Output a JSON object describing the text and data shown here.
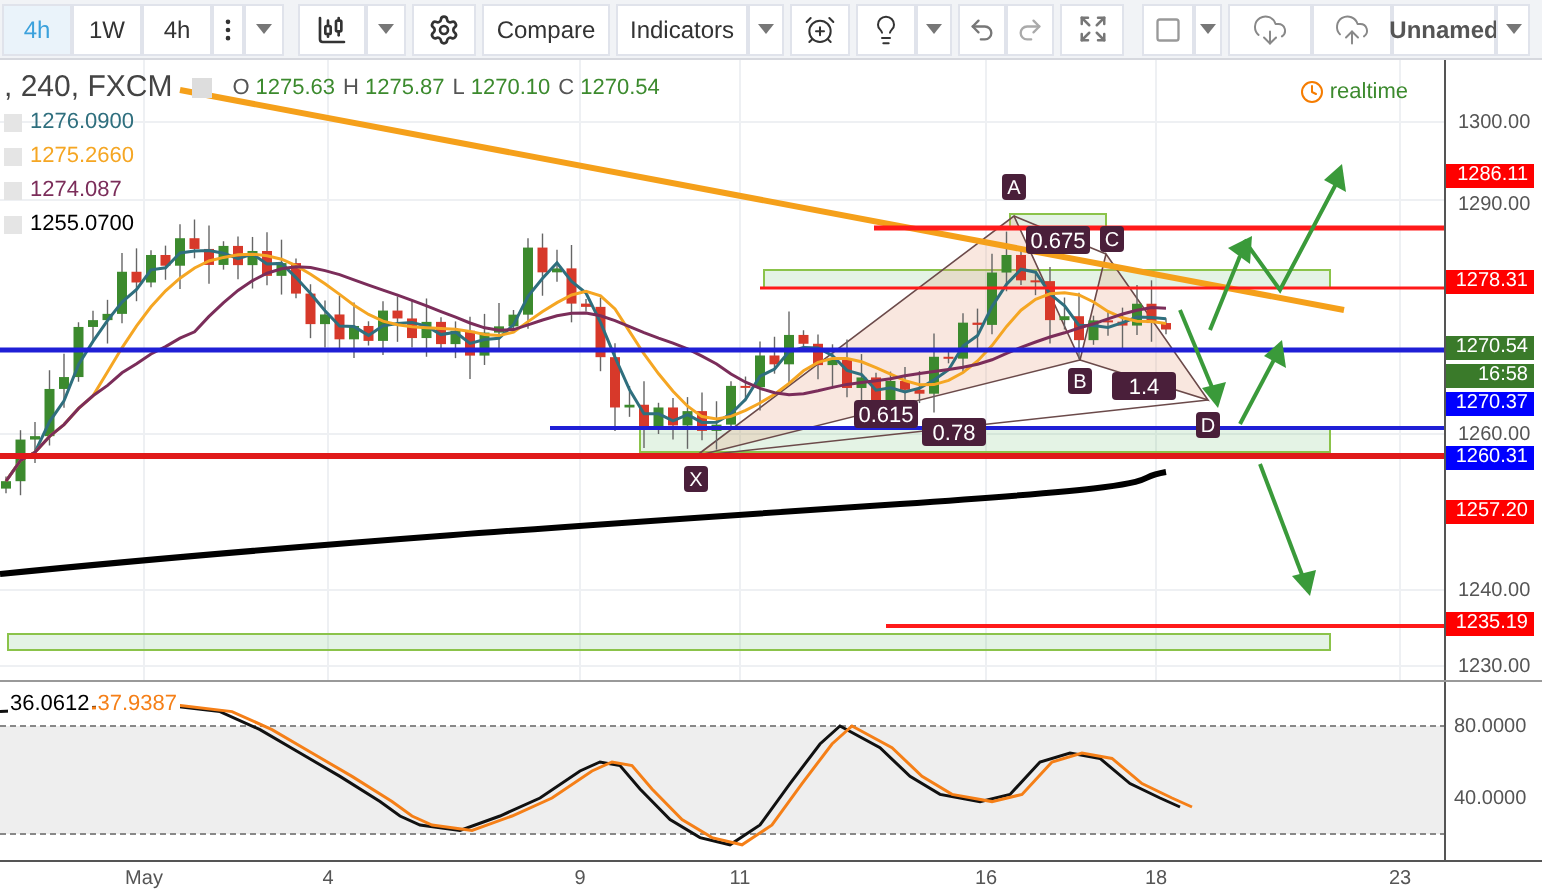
{
  "toolbar": {
    "interval_tabs": [
      {
        "label": "4h",
        "selected": true
      },
      {
        "label": "1W",
        "selected": false
      },
      {
        "label": "4h",
        "selected": false
      }
    ],
    "compare": "Compare",
    "indicators": "Indicators",
    "layout_name": "Unnamed"
  },
  "legend": {
    "symbol": ", 240, FXCM",
    "ohlc": [
      {
        "key": "O",
        "value": "1275.63"
      },
      {
        "key": "H",
        "value": "1275.87"
      },
      {
        "key": "L",
        "value": "1270.10"
      },
      {
        "key": "C",
        "value": "1270.54"
      }
    ],
    "indicators": [
      {
        "value": "1276.0900",
        "color": "#2f6f7e"
      },
      {
        "value": "1275.2660",
        "color": "#f5a623"
      },
      {
        "value": "1274.087",
        "color": "#7b2d5a"
      },
      {
        "value": "1255.0700",
        "color": "#000000"
      }
    ]
  },
  "realtime": "realtime",
  "pattern": {
    "points": [
      "X",
      "A",
      "B",
      "C",
      "D"
    ],
    "ratios": [
      "0.675",
      "0.615",
      "0.78",
      "1.4"
    ]
  },
  "price_axis": {
    "ticks": [
      "1300.00",
      "1290.00",
      "1260.00",
      "1240.00",
      "1230.00"
    ],
    "tags": [
      {
        "text": "1286.11",
        "color": "#ff0000"
      },
      {
        "text": "1278.31",
        "color": "#ff0000"
      },
      {
        "text": "1270.54",
        "color": "#3a7a2a"
      },
      {
        "text": "16:58",
        "color": "#3a7a2a"
      },
      {
        "text": "1270.37",
        "color": "#0000ff"
      },
      {
        "text": "1260.31",
        "color": "#0000ff"
      },
      {
        "text": "1257.20",
        "color": "#ff0000"
      },
      {
        "text": "1235.19",
        "color": "#ff0000"
      }
    ]
  },
  "oscillator": {
    "values": [
      {
        "text": "36.0612",
        "color": "#000000"
      },
      {
        "text": "37.9387",
        "color": "#f57f17"
      }
    ],
    "ticks": [
      "80.0000",
      "40.0000"
    ]
  },
  "time_axis": [
    "May",
    "4",
    "9",
    "11",
    "16",
    "18",
    "23"
  ]
}
